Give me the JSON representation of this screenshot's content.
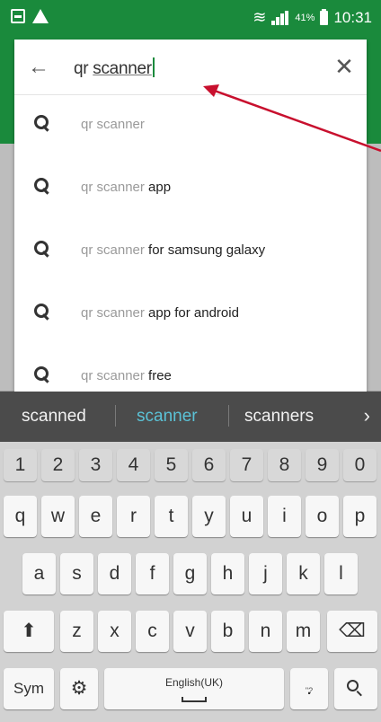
{
  "status_bar": {
    "battery": "41%",
    "time": "10:31",
    "icons": [
      "notification-icon",
      "warning-icon",
      "wifi-icon",
      "signal-icon",
      "battery-icon"
    ],
    "color": "#1a8a3c"
  },
  "search": {
    "query_prefix": "qr ",
    "query_typed": "scanner",
    "back_icon": "←",
    "clear_icon": "✕"
  },
  "suggestions": [
    {
      "prefix": "qr scanner",
      "suffix": ""
    },
    {
      "prefix": "qr scanner",
      "suffix": " app"
    },
    {
      "prefix": "qr scanner",
      "suffix": " for samsung galaxy"
    },
    {
      "prefix": "qr scanner",
      "suffix": " app for android"
    },
    {
      "prefix": "qr scanner",
      "suffix": " free"
    }
  ],
  "word_suggestions": {
    "items": [
      "scanned",
      "scanner",
      "scanners"
    ],
    "highlight_color": "#5bc2d6",
    "next": "›"
  },
  "keyboard": {
    "numbers": [
      "1",
      "2",
      "3",
      "4",
      "5",
      "6",
      "7",
      "8",
      "9",
      "0"
    ],
    "row1": [
      "q",
      "w",
      "e",
      "r",
      "t",
      "y",
      "u",
      "i",
      "o",
      "p"
    ],
    "row2": [
      "a",
      "s",
      "d",
      "f",
      "g",
      "h",
      "j",
      "k",
      "l"
    ],
    "row3": [
      "z",
      "x",
      "c",
      "v",
      "b",
      "n",
      "m"
    ],
    "shift": "⬆",
    "backspace": "⌫",
    "sym": "Sym",
    "settings": "⚙",
    "space_label": "English(UK)",
    "period": ".",
    "search": "🔍"
  }
}
